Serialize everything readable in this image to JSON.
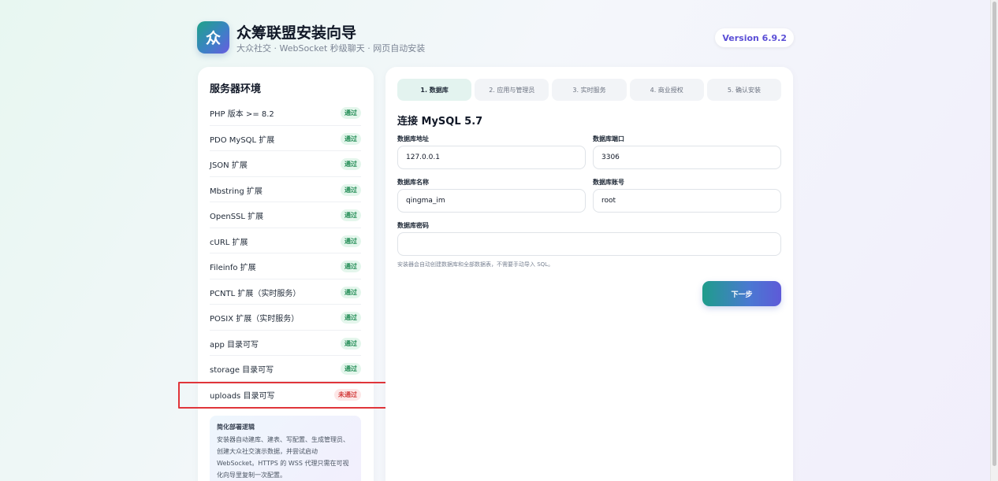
{
  "header": {
    "logo_text": "众",
    "title": "众筹联盟安装向导",
    "subtitle": "大众社交 · WebSocket 秒级聊天 · 网页自动安装",
    "version": "Version 6.9.2"
  },
  "env": {
    "title": "服务器环境",
    "items": [
      {
        "label": "PHP 版本 >= 8.2",
        "status": "通过"
      },
      {
        "label": "PDO MySQL 扩展",
        "status": "通过"
      },
      {
        "label": "JSON 扩展",
        "status": "通过"
      },
      {
        "label": "Mbstring 扩展",
        "status": "通过"
      },
      {
        "label": "OpenSSL 扩展",
        "status": "通过"
      },
      {
        "label": "cURL 扩展",
        "status": "通过"
      },
      {
        "label": "Fileinfo 扩展",
        "status": "通过"
      },
      {
        "label": "PCNTL 扩展（实时服务）",
        "status": "通过"
      },
      {
        "label": "POSIX 扩展（实时服务）",
        "status": "通过"
      },
      {
        "label": "app 目录可写",
        "status": "通过"
      },
      {
        "label": "storage 目录可写",
        "status": "通过"
      },
      {
        "label": "uploads 目录可写",
        "status": "未通过"
      }
    ]
  },
  "note": {
    "title": "简化部署逻辑",
    "text": "安装器自动建库、建表、写配置、生成管理员、创建大众社交演示数据，并尝试启动 WebSocket。HTTPS 的 WSS 代理只需在可视化向导里复制一次配置。"
  },
  "steps": [
    "1. 数据库",
    "2. 应用与管理员",
    "3. 实时服务",
    "4. 商业授权",
    "5. 确认安装"
  ],
  "form": {
    "section_title": "连接 MySQL 5.7",
    "db_host_label": "数据库地址",
    "db_host_value": "127.0.0.1",
    "db_port_label": "数据库端口",
    "db_port_value": "3306",
    "db_name_label": "数据库名称",
    "db_name_value": "qingma_im",
    "db_user_label": "数据库账号",
    "db_user_value": "root",
    "db_pass_label": "数据库密码",
    "db_pass_value": "",
    "hint": "安装器会自动创建数据库和全部数据表，不需要手动导入 SQL。",
    "next_label": "下一步"
  },
  "colors": {
    "accent_teal": "#1f9d8b",
    "accent_purple": "#5e5ad8",
    "pass_green": "#1e8a52",
    "fail_red": "#d23b3b",
    "highlight_red": "#e0353a"
  }
}
